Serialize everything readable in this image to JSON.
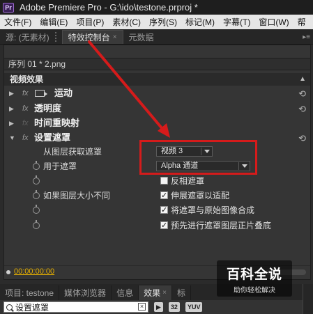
{
  "window": {
    "title": "Adobe Premiere Pro - G:\\ido\\testone.prproj *",
    "logo_text": "Pr"
  },
  "menu": {
    "items": [
      "文件(F)",
      "编辑(E)",
      "项目(P)",
      "素材(C)",
      "序列(S)",
      "标记(M)",
      "字幕(T)",
      "窗口(W)",
      "帮"
    ]
  },
  "tabs": {
    "source": "源: (无素材)",
    "effect_controls": "特效控制台",
    "metadata": "元数据"
  },
  "panel": {
    "sequence_clip": "序列 01 * 2.png",
    "section_title": "视频效果",
    "effects": [
      {
        "name": "运动"
      },
      {
        "name": "透明度"
      },
      {
        "name": "时间重映射"
      },
      {
        "name": "设置遮罩"
      }
    ],
    "props": {
      "get_matte_label": "从图层获取遮罩",
      "get_matte_value": "视频 3",
      "use_for_matte_label": "用于遮罩",
      "use_for_matte_value": "Alpha 通道",
      "invert_label": "反相遮罩",
      "if_sizes_differ_label": "如果图层大小不同",
      "stretch_label": "伸展遮罩以适配",
      "composite_label": "将遮罩与原始图像合成",
      "premultiply_label": "预先进行遮罩图层正片叠底"
    },
    "timecode": "00:00:00:00"
  },
  "bottom": {
    "tabs": [
      "项目: testone",
      "媒体浏览器",
      "信息",
      "效果",
      "标"
    ],
    "search_value": "设置遮罩",
    "badges": [
      "32",
      "YUV"
    ]
  },
  "watermark": {
    "main": "百科全说",
    "sub": "助你轻松解决"
  },
  "colors": {
    "annotation_red": "#d51b1b",
    "timecode": "#e8b100"
  }
}
